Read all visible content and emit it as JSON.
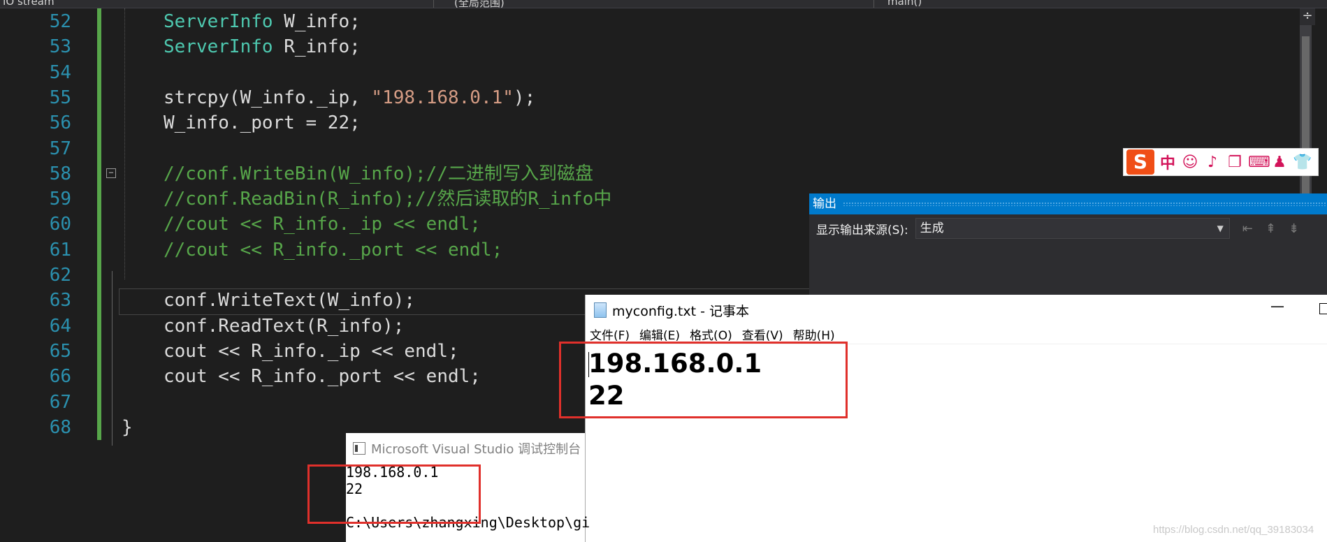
{
  "vs": {
    "tabs": [
      "IO stream",
      "(全局范围)",
      "main()"
    ],
    "lines": [
      {
        "num": "52",
        "segments": [
          {
            "t": "ServerInfo",
            "c": "ty"
          },
          {
            "t": " W_info;",
            "c": ""
          }
        ]
      },
      {
        "num": "53",
        "segments": [
          {
            "t": "ServerInfo",
            "c": "ty"
          },
          {
            "t": " R_info;",
            "c": ""
          }
        ]
      },
      {
        "num": "54",
        "segments": []
      },
      {
        "num": "55",
        "segments": [
          {
            "t": "strcpy(W_info._ip, ",
            "c": ""
          },
          {
            "t": "\"198.168.0.1\"",
            "c": "st"
          },
          {
            "t": ");",
            "c": ""
          }
        ]
      },
      {
        "num": "56",
        "segments": [
          {
            "t": "W_info._port = 22;",
            "c": ""
          }
        ]
      },
      {
        "num": "57",
        "segments": []
      },
      {
        "num": "58",
        "segments": [
          {
            "t": "//conf.WriteBin(W_info);//二进制写入到磁盘",
            "c": "cm"
          }
        ]
      },
      {
        "num": "59",
        "segments": [
          {
            "t": "//conf.ReadBin(R_info);//然后读取的R_info中",
            "c": "cm"
          }
        ]
      },
      {
        "num": "60",
        "segments": [
          {
            "t": "//cout << R_info._ip << endl;",
            "c": "cm"
          }
        ]
      },
      {
        "num": "61",
        "segments": [
          {
            "t": "//cout << R_info._port << endl;",
            "c": "cm"
          }
        ]
      },
      {
        "num": "62",
        "segments": []
      },
      {
        "num": "63",
        "segments": [
          {
            "t": "conf.WriteText(W_info);",
            "c": ""
          }
        ]
      },
      {
        "num": "64",
        "segments": [
          {
            "t": "conf.ReadText(R_info);",
            "c": ""
          }
        ]
      },
      {
        "num": "65",
        "segments": [
          {
            "t": "cout << R_info._ip << endl;",
            "c": ""
          }
        ]
      },
      {
        "num": "66",
        "segments": [
          {
            "t": "cout << R_info._port << endl;",
            "c": ""
          }
        ]
      },
      {
        "num": "67",
        "segments": []
      },
      {
        "num": "68",
        "segments": [
          {
            "t": "}",
            "c": ""
          }
        ]
      }
    ]
  },
  "output": {
    "title": "输出",
    "source_label": "显示输出来源(S):",
    "source_value": "生成"
  },
  "notepad": {
    "title": "myconfig.txt - 记事本",
    "menu": [
      "文件(F)",
      "编辑(E)",
      "格式(O)",
      "查看(V)",
      "帮助(H)"
    ],
    "text": "198.168.0.1\n22"
  },
  "console": {
    "title": "Microsoft Visual Studio 调试控制台",
    "text": "198.168.0.1\n22\n\nC:\\Users\\zhangxing\\Desktop\\gi"
  },
  "ime": {
    "logo": "S",
    "icons": [
      "中",
      "☺",
      "♪",
      "❐",
      "⌨",
      "♟",
      "👕"
    ]
  },
  "watermark": "https://blog.csdn.net/qq_39183034"
}
